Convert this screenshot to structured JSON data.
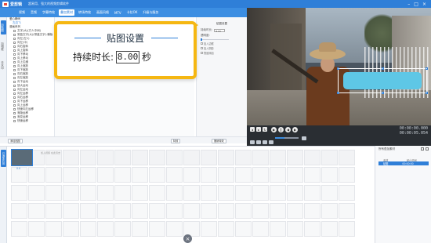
{
  "window": {
    "app_name": "爱剪辑",
    "slogan": "超易用、强大的视频剪辑软件"
  },
  "menu": [
    {
      "label": "视频",
      "active": false
    },
    {
      "label": "音频",
      "active": false
    },
    {
      "label": "字幕特效",
      "active": false
    },
    {
      "label": "叠加素材",
      "active": true
    },
    {
      "label": "转场特效",
      "active": false
    },
    {
      "label": "画面风格",
      "active": false
    },
    {
      "label": "MTV",
      "active": false
    },
    {
      "label": "卡拉OK",
      "active": false
    },
    {
      "label": "升级与服务",
      "active": false
    }
  ],
  "sidebar": [
    "加贴图",
    "加相框",
    "去水印"
  ],
  "effects": {
    "categories": [
      {
        "label": "爱心瞬间",
        "sub": false
      },
      {
        "label": "左边飞",
        "sub": true
      },
      {
        "label": "漫画系列",
        "sub": false
      }
    ],
    "items": [
      {
        "label": "文字(大)(方人中间)",
        "checked": false
      },
      {
        "label": "常蓝文字(大)(带盖文字)-横版",
        "checked": false
      },
      {
        "label": "向左(左1)",
        "checked": false
      },
      {
        "label": "向左(中)",
        "checked": false
      },
      {
        "label": "向右旋转",
        "checked": false
      },
      {
        "label": "向上旋转",
        "checked": false
      },
      {
        "label": "向下移动",
        "checked": false
      },
      {
        "label": "向上移动",
        "checked": false
      },
      {
        "label": "向上拉缓",
        "checked": false
      },
      {
        "label": "向上缩放",
        "checked": false
      },
      {
        "label": "向下缩放",
        "checked": false
      },
      {
        "label": "向右缩放",
        "checked": false
      },
      {
        "label": "向左缩放",
        "checked": false
      },
      {
        "label": "向下运动",
        "checked": false
      },
      {
        "label": "放大运动",
        "checked": false
      },
      {
        "label": "向左运动",
        "checked": false
      },
      {
        "label": "向左运移",
        "checked": false
      },
      {
        "label": "向右运移",
        "checked": false
      },
      {
        "label": "向下运移",
        "checked": false
      },
      {
        "label": "向上运移",
        "checked": false
      },
      {
        "label": "快速向左运移",
        "checked": false
      },
      {
        "label": "渐隐运移",
        "checked": false
      },
      {
        "label": "渐变运移",
        "checked": false
      },
      {
        "label": "快速运移",
        "checked": false
      }
    ]
  },
  "settings": {
    "title": "贴图设置",
    "duration_label": "持续时长:",
    "duration_value": "8.00",
    "transparency_label": "透明度:",
    "options": [
      "加入边框",
      "加入阴影",
      "快速添加"
    ]
  },
  "popup": {
    "title": "贴图设置",
    "duration_label": "持续时长:",
    "duration_value": "8.00",
    "unit": "秒"
  },
  "bottombar": {
    "add_button": "添加贴图",
    "effect_button": "特效",
    "restore_button": "撤销特效"
  },
  "player": {
    "time_current": "00:00:00.000",
    "time_total": "00:00:05.054"
  },
  "timeline": {
    "side_tab": "已添加片段",
    "clip_label": "0.0",
    "ghost_text": "加入视频 在此双击"
  },
  "stickerlist": {
    "title": "所有叠加素材",
    "col1": "素材",
    "col2": "起止时间",
    "row_label": "贴图",
    "row_time": "00:00:00"
  },
  "colors": {
    "titlebar": "#2f7fd8",
    "accent": "#2f7fd8",
    "popup_border": "#f5b712",
    "sticker": "#5ec7e6"
  }
}
